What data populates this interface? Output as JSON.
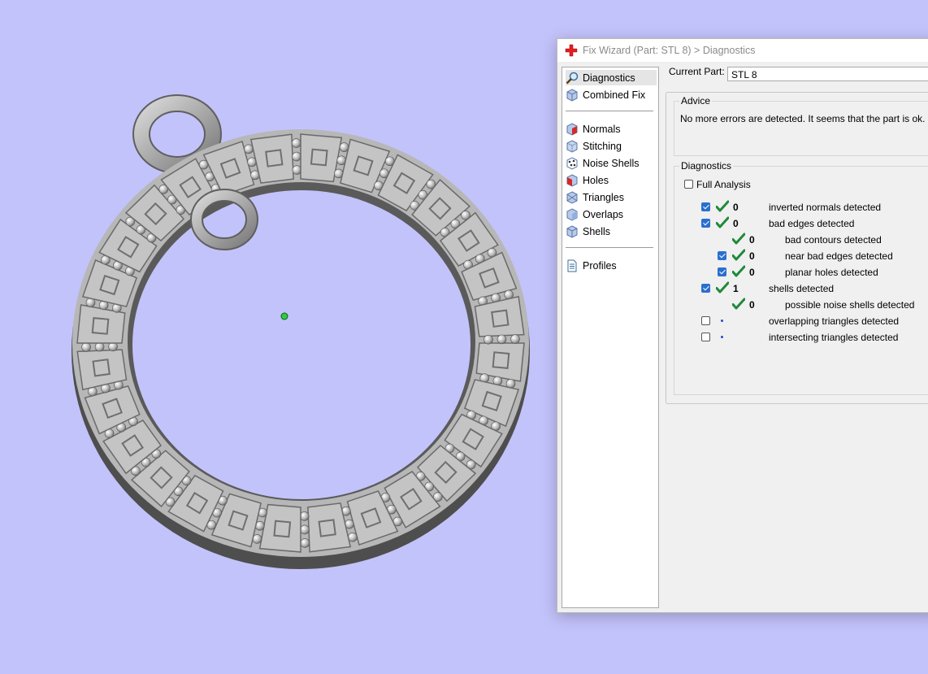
{
  "window": {
    "title": "Fix Wizard (Part: STL 8) > Diagnostics"
  },
  "nav": {
    "items": [
      {
        "label": "Diagnostics",
        "icon": "magnifier-icon"
      },
      {
        "label": "Combined Fix",
        "icon": "cube-icon"
      },
      {
        "label": "Normals",
        "icon": "normals-cube-icon"
      },
      {
        "label": "Stitching",
        "icon": "stitching-cube-icon"
      },
      {
        "label": "Noise Shells",
        "icon": "noise-shells-icon"
      },
      {
        "label": "Holes",
        "icon": "holes-cube-icon"
      },
      {
        "label": "Triangles",
        "icon": "triangles-cube-icon"
      },
      {
        "label": "Overlaps",
        "icon": "overlaps-cube-icon"
      },
      {
        "label": "Shells",
        "icon": "shells-cube-icon"
      },
      {
        "label": "Profiles",
        "icon": "document-icon"
      }
    ]
  },
  "part": {
    "label": "Current Part:",
    "value": "STL 8"
  },
  "advice": {
    "title": "Advice",
    "text": "No more errors are detected. It seems that the part is ok. Note"
  },
  "diagnostics": {
    "title": "Diagnostics",
    "full_analysis_label": "Full Analysis",
    "full_analysis_checked": false,
    "rows": [
      {
        "checkbox": "checked",
        "status": "ok",
        "count": "0",
        "label": "inverted normals detected",
        "indent": 0
      },
      {
        "checkbox": "checked",
        "status": "ok",
        "count": "0",
        "label": "bad edges detected",
        "indent": 0
      },
      {
        "checkbox": "none",
        "status": "ok",
        "count": "0",
        "label": "bad contours detected",
        "indent": 1
      },
      {
        "checkbox": "checked",
        "status": "ok",
        "count": "0",
        "label": "near bad edges detected",
        "indent": 1
      },
      {
        "checkbox": "checked",
        "status": "ok",
        "count": "0",
        "label": "planar holes detected",
        "indent": 1
      },
      {
        "checkbox": "checked",
        "status": "ok",
        "count": "1",
        "label": "shells detected",
        "indent": 0
      },
      {
        "checkbox": "none",
        "status": "ok",
        "count": "0",
        "label": "possible noise shells detected",
        "indent": 1
      },
      {
        "checkbox": "unchecked",
        "status": "pending",
        "count": "",
        "label": "overlapping triangles detected",
        "indent": 0
      },
      {
        "checkbox": "unchecked",
        "status": "pending",
        "count": "",
        "label": "intersecting triangles detected",
        "indent": 0
      }
    ]
  },
  "colors": {
    "background": "#c3c3fb",
    "check_green": "#1e8a3a",
    "checkbox_blue": "#2a6fcf",
    "model_gray": "#b4b4b4"
  }
}
